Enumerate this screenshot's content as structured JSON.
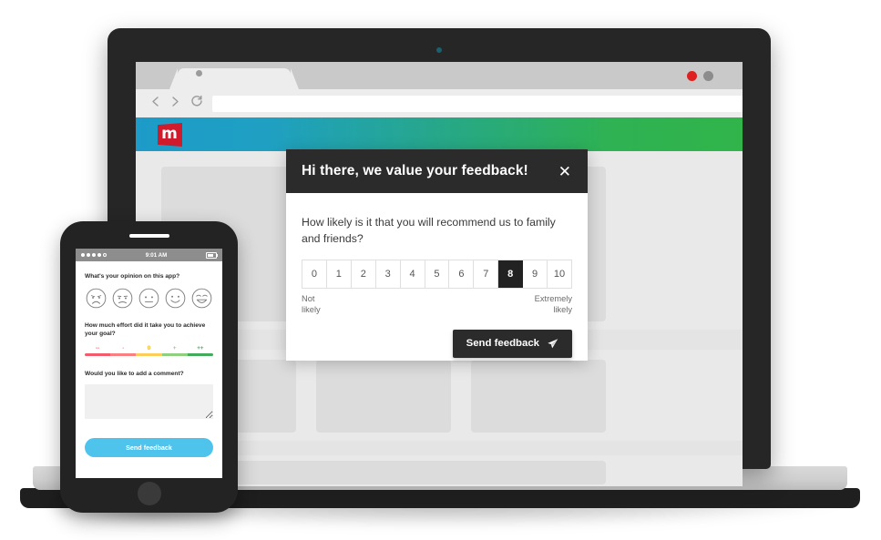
{
  "browser": {
    "nav": {
      "back_icon": "chevron-left-icon",
      "forward_icon": "chevron-right-icon",
      "reload_icon": "reload-icon"
    },
    "address_value": "",
    "address_placeholder": "",
    "window_controls": [
      {
        "name": "close",
        "color": "#e02020"
      },
      {
        "name": "minimize",
        "color": "#8c8c8c"
      },
      {
        "name": "maximize",
        "color": "#c9c9c9"
      }
    ]
  },
  "site": {
    "logo_letter": "m",
    "logo_color": "#cf1b2b",
    "header_gradient_from": "#1d9bc9",
    "header_gradient_to": "#31b44a"
  },
  "modal": {
    "title": "Hi there,  we value your feedback!",
    "close_label": "✕",
    "close_icon": "close-icon",
    "question": "How likely is it that you will recommend us to family and friends?",
    "scale": [
      "0",
      "1",
      "2",
      "3",
      "4",
      "5",
      "6",
      "7",
      "8",
      "9",
      "10"
    ],
    "selected": "8",
    "legend_low": "Not\nlikely",
    "legend_low_line1": "Not",
    "legend_low_line2": "likely",
    "legend_high_line1": "Extremely",
    "legend_high_line2": "likely",
    "send_label": "Send feedback",
    "send_icon": "paper-plane-icon",
    "accent": "#2b2b2b"
  },
  "phone": {
    "status": {
      "time": "9:01 AM",
      "signal_icon": "signal-dots-icon",
      "battery_icon": "battery-icon"
    },
    "question_opinion": "What's your opinion on this app?",
    "faces": [
      "face-very-sad-icon",
      "face-sad-icon",
      "face-neutral-icon",
      "face-happy-icon",
      "face-very-happy-icon"
    ],
    "question_effort": "How much effort did it take you to achieve your goal?",
    "effort_labels": [
      "--",
      "-",
      "0",
      "+",
      "++"
    ],
    "effort_colors": [
      "#f15b6c",
      "#f98080",
      "#fbcd5a",
      "#8ed07e",
      "#43ab5c"
    ],
    "question_comment": "Would you like to add a comment?",
    "comment_value": "",
    "comment_placeholder": "",
    "send_label": "Send feedback",
    "send_color": "#4ec3ec"
  }
}
